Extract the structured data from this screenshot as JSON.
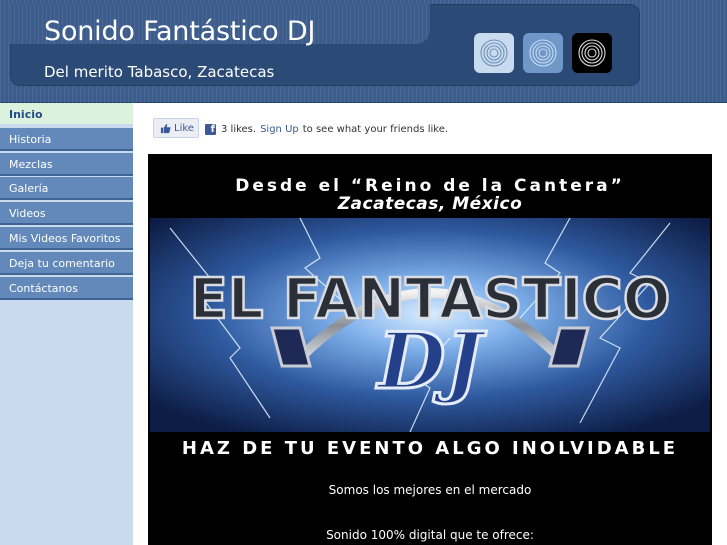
{
  "header": {
    "title": "Sonido Fantástico DJ",
    "subtitle": "Del merito Tabasco, Zacatecas",
    "logo_tiles": [
      {
        "icon": "concentric-rings-icon",
        "color": "#c9dcef"
      },
      {
        "icon": "concentric-rings-icon",
        "color": "#6f98c8"
      },
      {
        "icon": "concentric-rings-icon",
        "color": "#000000"
      }
    ]
  },
  "sidebar": {
    "items": [
      {
        "label": "Inicio",
        "active": true
      },
      {
        "label": "Historia"
      },
      {
        "label": "Mezclas"
      },
      {
        "label": "Galería"
      },
      {
        "label": "Videos"
      },
      {
        "label": "Mis Videos Favoritos"
      },
      {
        "label": "Deja tu comentario"
      },
      {
        "label": "Contáctanos"
      }
    ]
  },
  "facebook": {
    "like_label": "Like",
    "count_text": "3 likes.",
    "signup_label": "Sign Up",
    "suffix_text": "to see what your friends like."
  },
  "banner": {
    "line1": "Desde el “Reino de la Cantera”",
    "line2": "Zacatecas, México",
    "logo_text_top": "EL FANTASTICO",
    "logo_text_dj": "DJ",
    "line3": "HAZ DE TU EVENTO ALGO INOLVIDABLE",
    "line4": "Somos los mejores en el mercado",
    "line5": "Sonido 100% digital que te ofrece:"
  },
  "colors": {
    "header_bg": "#3b5c8c",
    "nav_bg": "#6289ba",
    "nav_active_bg": "#ddf2dc",
    "sidebar_bg": "#c9daef",
    "facebook_blue": "#3b5998"
  }
}
